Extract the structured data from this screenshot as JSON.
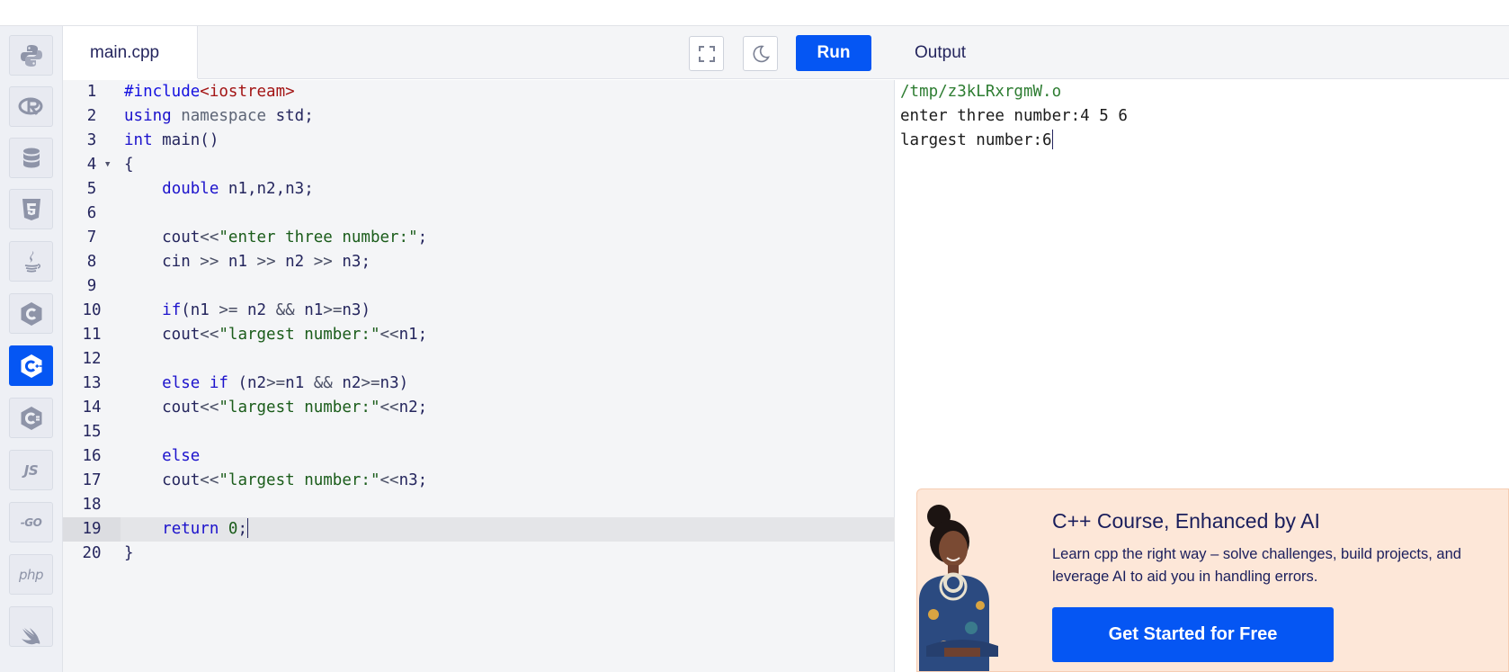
{
  "editor": {
    "file_name": "main.cpp",
    "run_label": "Run",
    "lines": [
      {
        "n": "1"
      },
      {
        "n": "2"
      },
      {
        "n": "3"
      },
      {
        "n": "4"
      },
      {
        "n": "5"
      },
      {
        "n": "6"
      },
      {
        "n": "7"
      },
      {
        "n": "8"
      },
      {
        "n": "9"
      },
      {
        "n": "10"
      },
      {
        "n": "11"
      },
      {
        "n": "12"
      },
      {
        "n": "13"
      },
      {
        "n": "14"
      },
      {
        "n": "15"
      },
      {
        "n": "16"
      },
      {
        "n": "17"
      },
      {
        "n": "18"
      },
      {
        "n": "19"
      },
      {
        "n": "20"
      }
    ],
    "code": {
      "l1_a": "#include",
      "l1_b": "<iostream>",
      "l2_a": "using",
      "l2_b": "namespace",
      "l2_c": " std;",
      "l3_a": "int",
      "l3_b": " main()",
      "l4_a": "{",
      "l5_a": "    ",
      "l5_b": "double",
      "l5_c": " n1,n2,n3;",
      "l7_a": "    cout",
      "l7_b": "<<",
      "l7_c": "\"enter three number:\"",
      "l7_d": ";",
      "l8_a": "    cin ",
      "l8_b": ">>",
      "l8_c": " n1 ",
      "l8_d": ">>",
      "l8_e": " n2 ",
      "l8_f": ">>",
      "l8_g": " n3;",
      "l10_a": "    ",
      "l10_b": "if",
      "l10_c": "(n1 ",
      "l10_d": ">=",
      "l10_e": " n2 ",
      "l10_f": "&&",
      "l10_g": " n1",
      "l10_h": ">=",
      "l10_i": "n3)",
      "l11_a": "    cout",
      "l11_b": "<<",
      "l11_c": "\"largest number:\"",
      "l11_d": "<<",
      "l11_e": "n1;",
      "l13_a": "    ",
      "l13_b": "else if",
      "l13_c": " (n2",
      "l13_d": ">=",
      "l13_e": "n1 ",
      "l13_f": "&&",
      "l13_g": " n2",
      "l13_h": ">=",
      "l13_i": "n3)",
      "l14_a": "    cout",
      "l14_b": "<<",
      "l14_c": "\"largest number:\"",
      "l14_d": "<<",
      "l14_e": "n2;",
      "l16_a": "    ",
      "l16_b": "else",
      "l17_a": "    cout",
      "l17_b": "<<",
      "l17_c": "\"largest number:\"",
      "l17_d": "<<",
      "l17_e": "n3;",
      "l19_a": "    ",
      "l19_b": "return",
      "l19_c": " ",
      "l19_d": "0",
      "l19_e": ";",
      "l20_a": "}"
    }
  },
  "output": {
    "title": "Output",
    "lines": [
      "/tmp/z3kLRxrgmW.o",
      "enter three number:4 5 6",
      "largest number:6"
    ]
  },
  "sidebar": {
    "items": [
      {
        "icon": "python-icon"
      },
      {
        "icon": "r-lang-icon"
      },
      {
        "icon": "sql-database-icon"
      },
      {
        "icon": "html5-icon"
      },
      {
        "icon": "java-icon"
      },
      {
        "icon": "c-lang-icon"
      },
      {
        "icon": "cpp-icon",
        "active": true
      },
      {
        "icon": "csharp-icon"
      },
      {
        "icon": "javascript-icon",
        "label": "JS"
      },
      {
        "icon": "go-icon",
        "label": "-GO"
      },
      {
        "icon": "php-icon",
        "label": "php"
      },
      {
        "icon": "swift-icon"
      }
    ]
  },
  "promo": {
    "title": "C++ Course, Enhanced by AI",
    "text": "Learn cpp the right way – solve challenges, build projects, and leverage AI to aid you in handling errors.",
    "cta": "Get Started for Free"
  },
  "colors": {
    "accent": "#0556f3",
    "keyword": "#1c12cc",
    "string": "#1a5c1a",
    "include": "#a31515",
    "promo_bg": "#fde7d8"
  }
}
